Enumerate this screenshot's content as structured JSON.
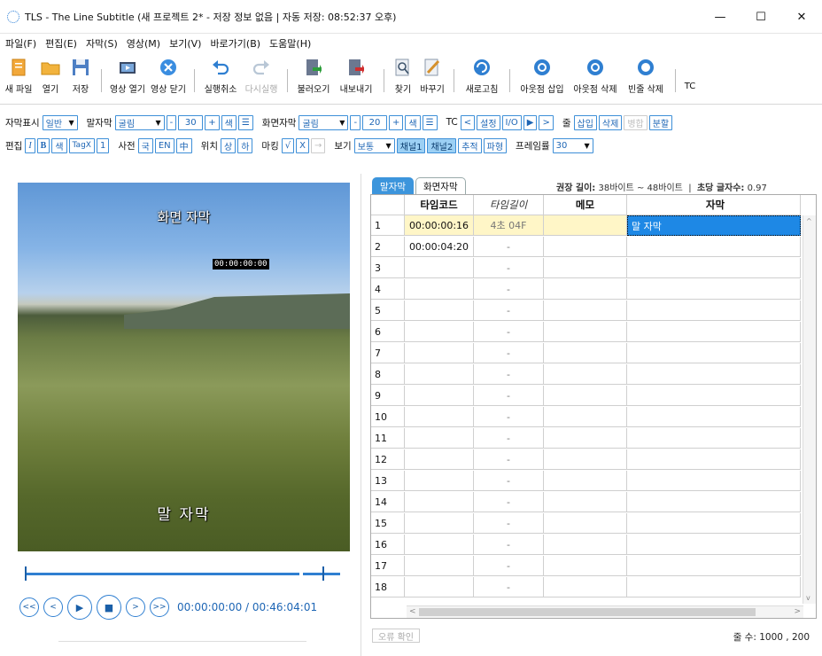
{
  "window": {
    "title": "TLS - The Line Subtitle (새 프로젝트 2* - 저장 정보 없음 | 자동 저장: 08:52:37 오후)",
    "minimize": "—",
    "maximize": "☐",
    "close": "✕"
  },
  "menu": [
    "파일(F)",
    "편집(E)",
    "자막(S)",
    "영상(M)",
    "보기(V)",
    "바로가기(B)",
    "도움말(H)"
  ],
  "toolbar": {
    "new_file": "새 파일",
    "open": "열기",
    "save": "저장",
    "open_video": "영상 열기",
    "close_video": "영상 닫기",
    "undo": "실행취소",
    "redo": "다시실행",
    "import": "불러오기",
    "export": "내보내기",
    "find": "찾기",
    "replace": "바꾸기",
    "refresh": "새로고침",
    "outpoint_insert": "아웃점 삽입",
    "outpoint_delete": "아웃점 삭제",
    "blank_delete": "빈줄 삭제",
    "tc": "TC"
  },
  "options1": {
    "display_label": "자막표시",
    "display_value": "일반",
    "speech_label": "말자막",
    "speech_font": "굴림",
    "minus": "-",
    "speech_size": "30",
    "plus": "+",
    "color": "색",
    "align_icon": "☰",
    "screen_label": "화면자막",
    "screen_font": "굴림",
    "screen_size": "20",
    "tc_label": "TC",
    "tc_left": "<",
    "tc_set": "설정",
    "tc_io": "I/O",
    "tc_play": "▶",
    "tc_right": ">",
    "line_label": "줄",
    "line_insert": "삽입",
    "line_delete": "삭제",
    "line_merge": "병합",
    "line_split": "분할"
  },
  "options2": {
    "edit_label": "편집",
    "italic": "I",
    "bold": "B",
    "color": "색",
    "tagx": "TagX",
    "one": "1",
    "dict_label": "사전",
    "dict_ko": "국",
    "dict_en": "EN",
    "dict_cn": "中",
    "pos_label": "위치",
    "pos_top": "상",
    "pos_bottom": "하",
    "mark_label": "마킹",
    "mark_check": "√",
    "mark_x": "X",
    "mark_arrow": "→",
    "view_label": "보기",
    "view_value": "보통",
    "ch1": "채널1",
    "ch2": "채널2",
    "track": "추적",
    "wave": "파형",
    "fps_label": "프레임률",
    "fps_value": "30"
  },
  "video": {
    "screen_subtitle": "화면 자막",
    "timecode_overlay": "00:00:00:00",
    "speech_subtitle": "말 자막",
    "playtime": "00:00:00:00 / 00:46:04:01"
  },
  "tabs": [
    "말자막",
    "화면자막"
  ],
  "info": {
    "recommended_label": "권장 길이:",
    "recommended_value": "38바이트 ~ 48바이트",
    "sep": "|",
    "cps_label": "초당 글자수:",
    "cps_value": "0.97"
  },
  "grid": {
    "headers": [
      "타임코드",
      "타임길이",
      "메모",
      "자막"
    ],
    "rows": [
      {
        "num": "1",
        "tc": "00:00:00:16",
        "len": "4초 04F",
        "memo": "",
        "sub": "말 자막"
      },
      {
        "num": "2",
        "tc": "00:00:04:20",
        "len": "-",
        "memo": "",
        "sub": ""
      },
      {
        "num": "3",
        "tc": "",
        "len": "-",
        "memo": "",
        "sub": ""
      },
      {
        "num": "4",
        "tc": "",
        "len": "-",
        "memo": "",
        "sub": ""
      },
      {
        "num": "5",
        "tc": "",
        "len": "-",
        "memo": "",
        "sub": ""
      },
      {
        "num": "6",
        "tc": "",
        "len": "-",
        "memo": "",
        "sub": ""
      },
      {
        "num": "7",
        "tc": "",
        "len": "-",
        "memo": "",
        "sub": ""
      },
      {
        "num": "8",
        "tc": "",
        "len": "-",
        "memo": "",
        "sub": ""
      },
      {
        "num": "9",
        "tc": "",
        "len": "-",
        "memo": "",
        "sub": ""
      },
      {
        "num": "10",
        "tc": "",
        "len": "-",
        "memo": "",
        "sub": ""
      },
      {
        "num": "11",
        "tc": "",
        "len": "-",
        "memo": "",
        "sub": ""
      },
      {
        "num": "12",
        "tc": "",
        "len": "-",
        "memo": "",
        "sub": ""
      },
      {
        "num": "13",
        "tc": "",
        "len": "-",
        "memo": "",
        "sub": ""
      },
      {
        "num": "14",
        "tc": "",
        "len": "-",
        "memo": "",
        "sub": ""
      },
      {
        "num": "15",
        "tc": "",
        "len": "-",
        "memo": "",
        "sub": ""
      },
      {
        "num": "16",
        "tc": "",
        "len": "-",
        "memo": "",
        "sub": ""
      },
      {
        "num": "17",
        "tc": "",
        "len": "-",
        "memo": "",
        "sub": ""
      },
      {
        "num": "18",
        "tc": "",
        "len": "-",
        "memo": "",
        "sub": ""
      }
    ]
  },
  "footer": {
    "error_check": "오류 확인",
    "row_count": "줄 수: 1000 , 200"
  },
  "colors": {
    "accent": "#3c95dc",
    "selection": "#1e88e5",
    "highlight": "#fff6c7"
  }
}
